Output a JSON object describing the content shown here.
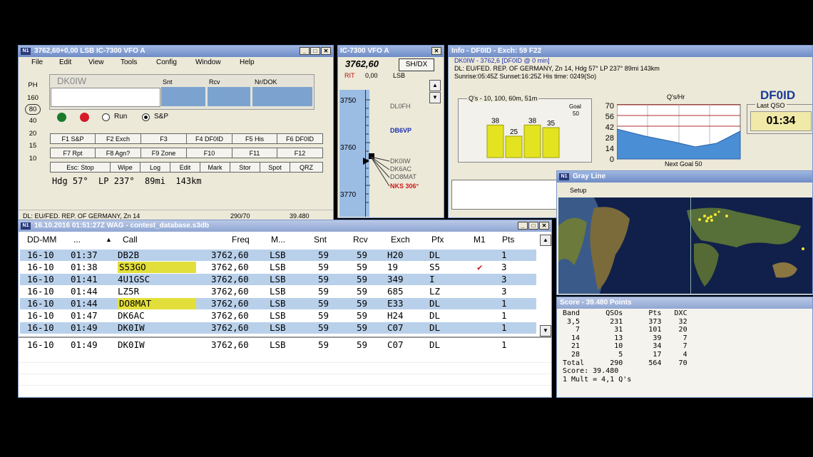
{
  "vfo": {
    "title": "3762,60+0,00 LSB IC-7300 VFO A",
    "menu": [
      "File",
      "Edit",
      "View",
      "Tools",
      "Config",
      "Window",
      "Help"
    ],
    "call_value": "DK0IW",
    "col_snt": "Snt",
    "col_rcv": "Rcv",
    "col_nr": "Nr/DOK",
    "bands": [
      "PH",
      "160",
      "80",
      "40",
      "20",
      "15",
      "10"
    ],
    "run_label": "Run",
    "sp_label": "S&P",
    "fkeys": [
      "F1 S&P",
      "F2 Exch",
      "F3",
      "F4 DF0ID",
      "F5 His",
      "F6 DF0ID",
      "F7 Rpt",
      "F8 Agn?",
      "F9 Zone",
      "F10",
      "F11",
      "F12",
      "Esc: Stop",
      "Wipe",
      "Log",
      "Edit",
      "Mark",
      "Stor",
      "Spot",
      "QRZ"
    ],
    "heading": "Hdg 57°  LP 237°  89mi  143km",
    "status_left": "DL: EU/FED. REP. OF GERMANY, Zn 14",
    "status_mid": "290/70",
    "status_right": "39.480"
  },
  "bandmap": {
    "title": "IC-7300 VFO A",
    "freq": "3762,60",
    "mode_btn": "SH/DX",
    "rit": "RIT",
    "rit_val": "0,00",
    "mode": "LSB",
    "ticks": [
      "3750",
      "3760",
      "3770"
    ],
    "spots": [
      {
        "call": "DL0FH",
        "color": "#555555"
      },
      {
        "call": "DB6VP",
        "color": "#1a2fb0"
      },
      {
        "call": "DK0IW",
        "color": "#555555"
      },
      {
        "call": "DK6AC",
        "color": "#555555"
      },
      {
        "call": "DO8MAT",
        "color": "#555555"
      },
      {
        "call": "NKS 306°",
        "color": "#d01818"
      }
    ]
  },
  "info": {
    "title": "Info - DF0ID - Exch: 59 F22",
    "line1": "DK0IW - 3762,6 [DF0ID @ 0 min]",
    "line2": "DL: EU/FED. REP. OF GERMANY, Zn 14, Hdg 57° LP 237° 89mi 143km",
    "line3": "Sunrise:05:45Z Sunset:16:25Z His time: 0249(So)",
    "qs_title": "Q's - 10, 100, 60m, 51m",
    "goal_label": "Goal",
    "goal_value": "50",
    "bar_values": [
      38,
      25,
      38,
      35
    ],
    "rate_title": "Q's/Hr",
    "rate_ticks": [
      "70",
      "56",
      "42",
      "28",
      "14",
      "0"
    ],
    "next_goal": "Next Goal 50",
    "callsign": "DF0ID",
    "last_qso_label": "Last QSO",
    "last_qso_time": "01:34"
  },
  "grayline": {
    "title": "Gray Line",
    "setup": "Setup"
  },
  "log": {
    "title": "16.10.2016 01:51:27Z  WAG - contest_database.s3db",
    "headers": [
      "DD-MM",
      "...",
      "Call",
      "Freq",
      "M...",
      "Snt",
      "Rcv",
      "Exch",
      "Pfx",
      "M1",
      "Pts"
    ],
    "rows": [
      {
        "date": "16-10",
        "time": "01:37",
        "call": "DB2B",
        "freq": "3762,60",
        "mode": "LSB",
        "snt": "59",
        "rcv": "59",
        "exch": "H20",
        "pfx": "DL",
        "m1": "",
        "pts": "1"
      },
      {
        "date": "16-10",
        "time": "01:38",
        "call": "S53GO",
        "freq": "3762,60",
        "mode": "LSB",
        "snt": "59",
        "rcv": "59",
        "exch": "19",
        "pfx": "S5",
        "m1": "✔",
        "pts": "3"
      },
      {
        "date": "16-10",
        "time": "01:41",
        "call": "4U1GSC",
        "freq": "3762,60",
        "mode": "LSB",
        "snt": "59",
        "rcv": "59",
        "exch": "349",
        "pfx": "I",
        "m1": "",
        "pts": "3"
      },
      {
        "date": "16-10",
        "time": "01:44",
        "call": "LZ5R",
        "freq": "3762,60",
        "mode": "LSB",
        "snt": "59",
        "rcv": "59",
        "exch": "685",
        "pfx": "LZ",
        "m1": "",
        "pts": "3"
      },
      {
        "date": "16-10",
        "time": "01:44",
        "call": "DO8MAT",
        "freq": "3762,60",
        "mode": "LSB",
        "snt": "59",
        "rcv": "59",
        "exch": "E33",
        "pfx": "DL",
        "m1": "",
        "pts": "1"
      },
      {
        "date": "16-10",
        "time": "01:47",
        "call": "DK6AC",
        "freq": "3762,60",
        "mode": "LSB",
        "snt": "59",
        "rcv": "59",
        "exch": "H24",
        "pfx": "DL",
        "m1": "",
        "pts": "1"
      },
      {
        "date": "16-10",
        "time": "01:49",
        "call": "DK0IW",
        "freq": "3762,60",
        "mode": "LSB",
        "snt": "59",
        "rcv": "59",
        "exch": "C07",
        "pfx": "DL",
        "m1": "",
        "pts": "1"
      }
    ],
    "entry": {
      "date": "16-10",
      "time": "01:49",
      "call": "DK0IW",
      "freq": "3762,60",
      "mode": "LSB",
      "snt": "59",
      "rcv": "59",
      "exch": "C07",
      "pfx": "DL",
      "pts": "1"
    }
  },
  "score": {
    "title": "Score - 39.480 Points",
    "lines": [
      "Band      QSOs      Pts   DXC",
      " 3,5       231      373    32",
      "   7        31      101    20",
      "  14        13       39     7",
      "  21        10       34     7",
      "  28         5       17     4",
      "Total      290      564    70",
      "Score: 39.480",
      "1 Mult = 4,1 Q's"
    ]
  }
}
